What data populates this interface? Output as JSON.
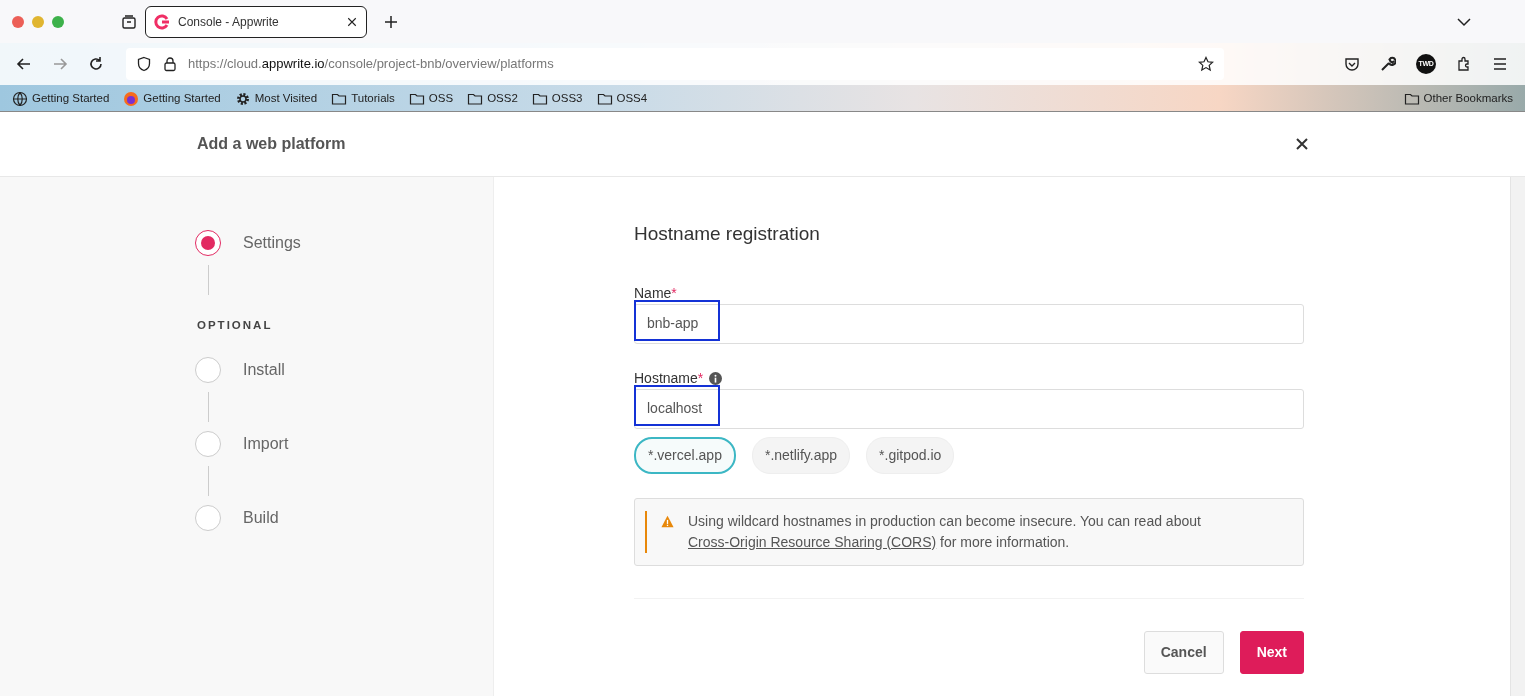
{
  "browser": {
    "tab": {
      "title": "Console - Appwrite"
    },
    "url": [
      {
        "text": "https://cloud.",
        "emphasis": false
      },
      {
        "text": "appwrite.io",
        "emphasis": true
      },
      {
        "text": "/console/project-bnb/overview/platforms",
        "emphasis": false
      }
    ],
    "avatar": "TWD",
    "bookmarks": [
      {
        "label": "Getting Started",
        "kind": "globe"
      },
      {
        "label": "Getting Started",
        "kind": "firefox"
      },
      {
        "label": "Most Visited",
        "kind": "gear"
      },
      {
        "label": "Tutorials",
        "kind": "folder"
      },
      {
        "label": "OSS",
        "kind": "folder"
      },
      {
        "label": "OSS2",
        "kind": "folder"
      },
      {
        "label": "OSS3",
        "kind": "folder"
      },
      {
        "label": "OSS4",
        "kind": "folder"
      }
    ],
    "other_bookmarks": "Other Bookmarks"
  },
  "modal": {
    "title": "Add a web platform"
  },
  "steps": [
    {
      "label": "Settings",
      "selected": true
    }
  ],
  "optional_heading": "OPTIONAL",
  "optional_steps": [
    {
      "label": "Install",
      "selected": false
    },
    {
      "label": "Import",
      "selected": false
    },
    {
      "label": "Build",
      "selected": false
    }
  ],
  "form": {
    "title": "Hostname registration",
    "fields": [
      {
        "label": "Name",
        "required_mark": "*",
        "info": false,
        "value": "bnb-app",
        "highlighted": true
      },
      {
        "label": "Hostname",
        "required_mark": "*",
        "info": true,
        "value": "localhost",
        "highlighted": true
      }
    ],
    "suggestions": [
      {
        "label": "*.vercel.app",
        "selected": true
      },
      {
        "label": "*.netlify.app",
        "selected": false
      },
      {
        "label": "*.gitpod.io",
        "selected": false
      }
    ],
    "alert": {
      "text": "Using wildcard hostnames in production can become insecure. You can read about ",
      "link": "Cross-Origin Resource Sharing (CORS)",
      "text_after": " for more information."
    },
    "buttons": [
      {
        "label": "Cancel",
        "kind": "secondary"
      },
      {
        "label": "Next",
        "kind": "primary"
      }
    ]
  }
}
